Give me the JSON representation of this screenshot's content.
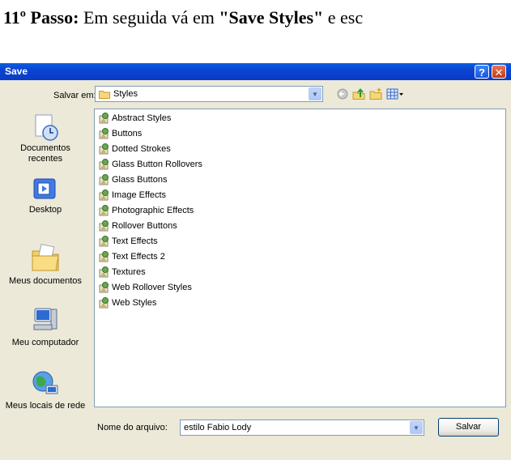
{
  "instruction": {
    "step": "11º Passo:",
    "text_before": " Em seguida vá em ",
    "bold_target": "\"Save Styles\"",
    "text_after": " e esc"
  },
  "dialog": {
    "title": "Save",
    "help_glyph": "?",
    "close_glyph": "✕"
  },
  "look_in": {
    "label": "Salvar em:",
    "value": "Styles"
  },
  "places": [
    {
      "label": "Documentos recentes",
      "icon": "recent-documents-icon"
    },
    {
      "label": "Desktop",
      "icon": "desktop-icon"
    },
    {
      "label": "Meus documentos",
      "icon": "my-documents-icon"
    },
    {
      "label": "Meu computador",
      "icon": "my-computer-icon"
    },
    {
      "label": "Meus locais de rede",
      "icon": "network-places-icon"
    }
  ],
  "files": [
    "Abstract Styles",
    "Buttons",
    "Dotted Strokes",
    "Glass Button Rollovers",
    "Glass Buttons",
    "Image Effects",
    "Photographic Effects",
    "Rollover Buttons",
    "Text Effects",
    "Text Effects 2",
    "Textures",
    "Web Rollover Styles",
    "Web Styles"
  ],
  "filename": {
    "label": "Nome do arquivo:",
    "value": "estilo Fabio Lody"
  },
  "buttons": {
    "save": "Salvar"
  }
}
